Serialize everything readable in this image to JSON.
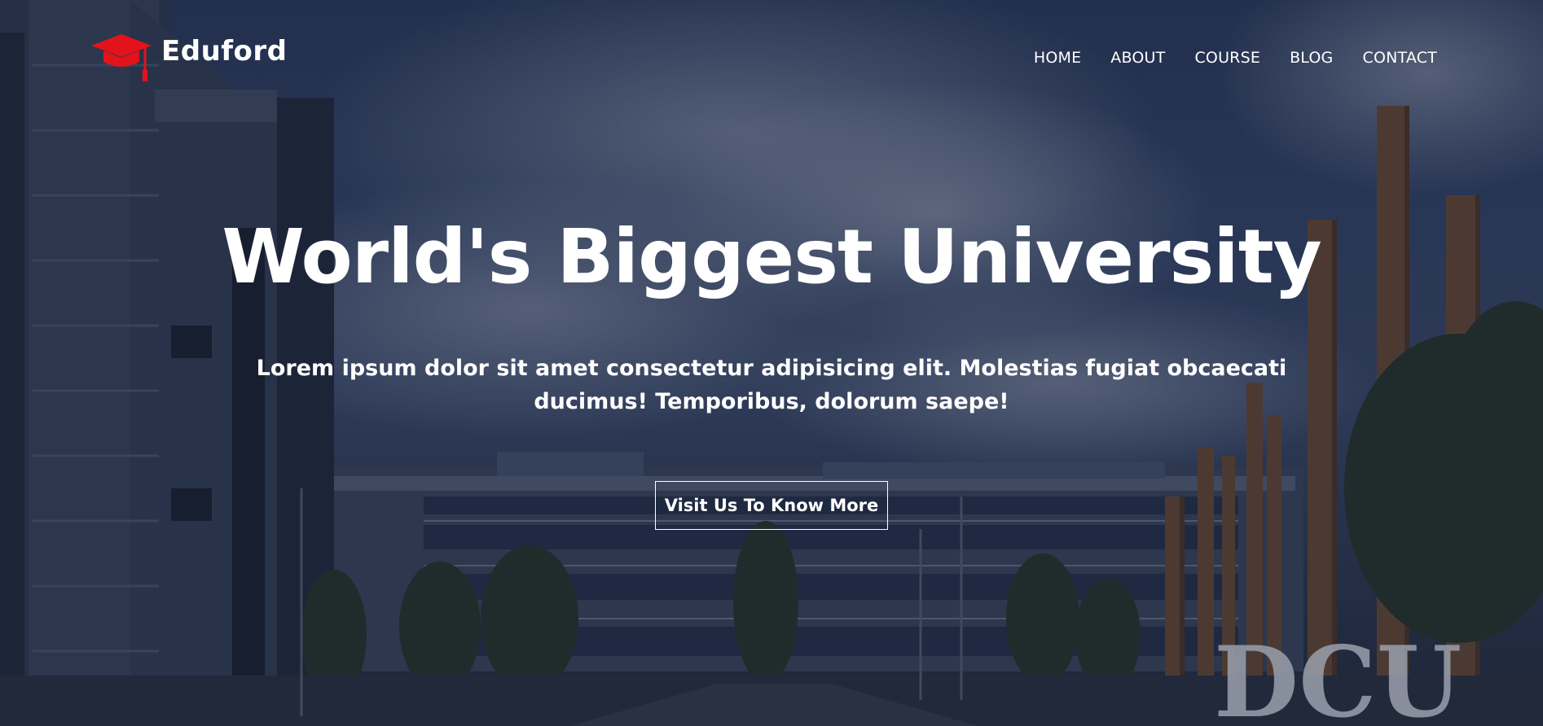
{
  "brand": {
    "name": "Eduford",
    "logo_icon": "graduation-cap-icon",
    "accent_color": "#e3131b"
  },
  "nav": {
    "items": [
      {
        "label": "HOME"
      },
      {
        "label": "ABOUT"
      },
      {
        "label": "COURSE"
      },
      {
        "label": "BLOG"
      },
      {
        "label": "CONTACT"
      }
    ]
  },
  "hero": {
    "title": "World's Biggest University",
    "subtitle": "Lorem ipsum dolor sit amet consectetur adipisicing elit. Molestias fugiat obcaecati ducimus! Temporibus, dolorum saepe!",
    "cta_label": "Visit Us To Know More",
    "background_sign": "DCU"
  }
}
